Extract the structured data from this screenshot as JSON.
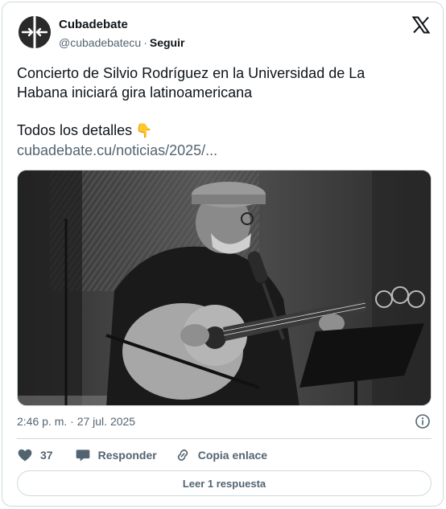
{
  "author": {
    "display_name": "Cubadebate",
    "handle": "@cubadebatecu",
    "separator": "·",
    "follow_label": "Seguir"
  },
  "tweet": {
    "line1": "Concierto de Silvio Rodríguez en la Universidad de La",
    "line2": "Habana iniciará gira latinoamericana",
    "details": "Todos los detalles",
    "details_emoji": "👇",
    "link": "cubadebate.cu/noticias/2025/..."
  },
  "media": {
    "alt_icon": "photo-of-guitarist-on-stage"
  },
  "meta": {
    "timestamp": "2:46 p. m. · 27 jul. 2025"
  },
  "actions": {
    "like_count": "37",
    "reply_label": "Responder",
    "copy_label": "Copia enlace"
  },
  "read_replies_label": "Leer 1 respuesta",
  "colors": {
    "text": "#0f1419",
    "secondary": "#536471",
    "border": "#cfd9de"
  }
}
